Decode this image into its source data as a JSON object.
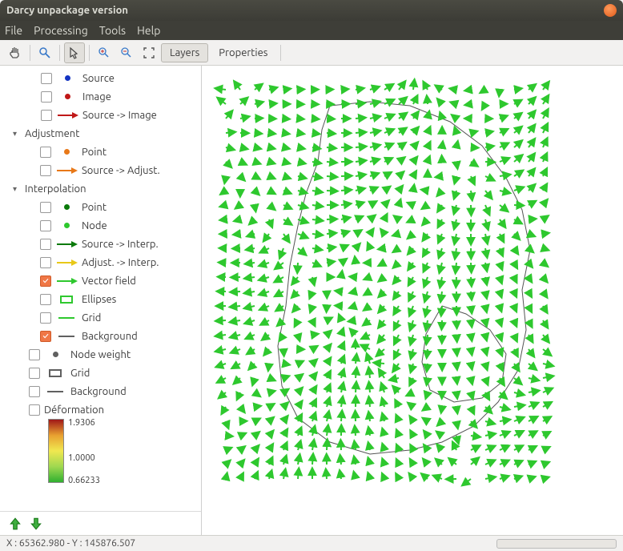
{
  "window": {
    "title": "Darcy unpackage version"
  },
  "menu": {
    "file": "File",
    "processing": "Processing",
    "tools": "Tools",
    "help": "Help"
  },
  "tabs": {
    "layers": "Layers",
    "properties": "Properties"
  },
  "tree": {
    "source": "Source",
    "image": "Image",
    "source_image": "Source -> Image",
    "adjustment": "Adjustment",
    "adj_point": "Point",
    "adj_source_adjust": "Source -> Adjust.",
    "interpolation": "Interpolation",
    "int_point": "Point",
    "int_node": "Node",
    "int_src_interp": "Source -> Interp.",
    "int_adj_interp": "Adjust. -> Interp.",
    "int_vector": "Vector field",
    "int_ellipses": "Ellipses",
    "int_grid": "Grid",
    "int_background": "Background",
    "node_weight": "Node weight",
    "grid2": "Grid",
    "background2": "Background",
    "deformation": "Déformation",
    "grad_max": "1.9306",
    "grad_mid": "1.0000",
    "grad_min": "0.66233"
  },
  "status": {
    "coords": "X : 65362.980 - Y : 145876.507"
  },
  "colors": {
    "green": "#2ec82e",
    "darkgreen": "#0a7a0a",
    "blue": "#1434c2",
    "red": "#c01818",
    "orange": "#e87818",
    "yellow": "#e8c818",
    "gray": "#606060"
  }
}
